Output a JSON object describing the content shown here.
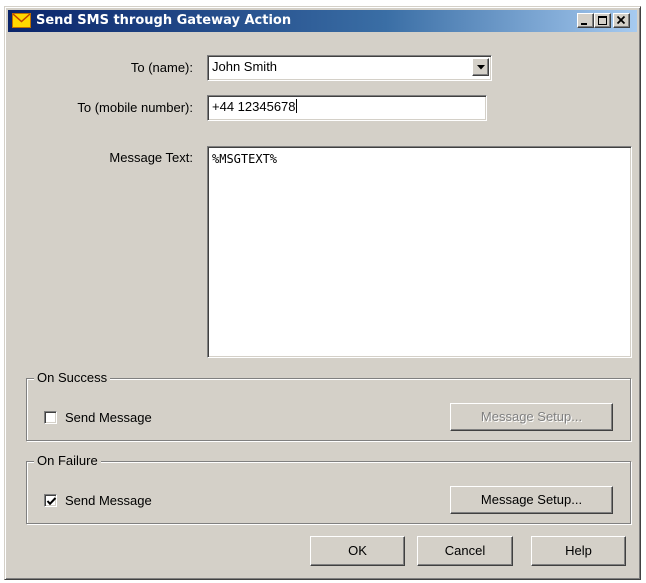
{
  "window": {
    "title": "Send SMS through Gateway Action",
    "title_icon": "envelope-icon",
    "caption_buttons": [
      "minimize-icon",
      "maximize-icon",
      "close-icon"
    ]
  },
  "form": {
    "to_name_label": "To (name):",
    "to_name_value": "John Smith",
    "to_mobile_label": "To (mobile number):",
    "to_mobile_value": "+44 12345678",
    "message_label": "Message Text:",
    "message_value": "%MSGTEXT%"
  },
  "on_success": {
    "title": "On Success",
    "send_label": "Send Message",
    "send_checked": false,
    "setup_label": "Message Setup...",
    "setup_enabled": false
  },
  "on_failure": {
    "title": "On Failure",
    "send_label": "Send Message",
    "send_checked": true,
    "setup_label": "Message Setup...",
    "setup_enabled": true
  },
  "buttons": {
    "ok": "OK",
    "cancel": "Cancel",
    "help": "Help"
  },
  "colors": {
    "face": "#d4d0c8",
    "titlebar_start": "#0a246a",
    "titlebar_end": "#a6caf0"
  }
}
